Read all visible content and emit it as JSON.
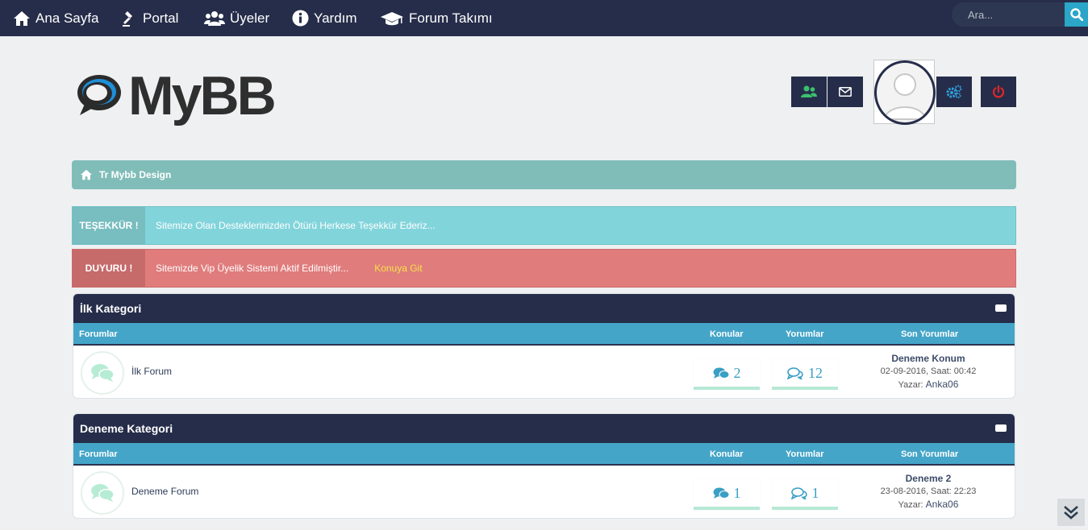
{
  "nav": {
    "items": [
      {
        "label": "Ana Sayfa",
        "icon": "home-icon"
      },
      {
        "label": "Portal",
        "icon": "gavel-icon"
      },
      {
        "label": "Üyeler",
        "icon": "users-icon"
      },
      {
        "label": "Yardım",
        "icon": "info-icon"
      },
      {
        "label": "Forum Takımı",
        "icon": "graduation-cap-icon"
      }
    ],
    "search_placeholder": "Ara..."
  },
  "header": {
    "logo_text": "MyBB"
  },
  "breadcrumb": {
    "label": "Tr Mybb Design"
  },
  "notices": [
    {
      "label": "TEŞEKKÜR !",
      "text": "Sitemize Olan Desteklerinizden Ötürü Herkese Teşekkür Ederiz...",
      "link": ""
    },
    {
      "label": "DUYURU !",
      "text": "Sitemizde Vip Üyelik Sistemi Aktif Edilmiştir...",
      "link": "Konuya Git"
    }
  ],
  "columns": {
    "forums": "Forumlar",
    "topics": "Konular",
    "replies": "Yorumlar",
    "last": "Son Yorumlar"
  },
  "categories": [
    {
      "title": "İlk Kategori",
      "forum": {
        "name": "İlk Forum",
        "topics": "2",
        "replies": "12",
        "last_title": "Deneme Konum",
        "last_date": "02-09-2016, Saat: 00:42",
        "last_author_prefix": "Yazar:",
        "last_author": "Anka06"
      }
    },
    {
      "title": "Deneme Kategori",
      "forum": {
        "name": "Deneme Forum",
        "topics": "1",
        "replies": "1",
        "last_title": "Deneme 2",
        "last_date": "23-08-2016, Saat: 22:23",
        "last_author_prefix": "Yazar:",
        "last_author": "Anka06"
      }
    }
  ],
  "colors": {
    "nav_bg": "#262d4a",
    "breadcrumb_bg": "#80bdb9",
    "thanks_bg": "#82d4db",
    "thanks_label_bg": "#78bdc0",
    "announce_bg": "#e07c7c",
    "announce_label_bg": "#c66a6a",
    "column_bar": "#44a5c8"
  }
}
